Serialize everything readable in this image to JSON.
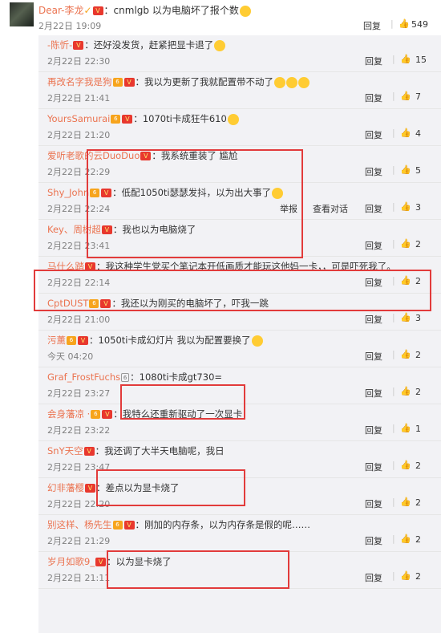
{
  "top": {
    "username": "Dear-李龙",
    "text": "：cnmlgb 以为电脑坏了报个数",
    "date": "2月22日 19:09",
    "reply": "回复",
    "sep": "|",
    "like_count": "549"
  },
  "badges": {
    "vip": "V",
    "level": "6",
    "gray": "6"
  },
  "actions": {
    "reply": "回复",
    "sep": "|",
    "report": "举报",
    "view_conversation": "查看对话"
  },
  "comments": [
    {
      "username": "-陈忻-",
      "text": "：还好没发货，赶紧把显卡退了",
      "date": "2月22日 22:30",
      "likes": "15"
    },
    {
      "username": "再改名字我是狗",
      "text": "：我以为更新了我就配置带不动了",
      "date": "2月22日 21:41",
      "likes": "7"
    },
    {
      "username": "YoursSamurai",
      "text": "：1070ti卡成狂牛610",
      "date": "2月22日 21:20",
      "likes": "4"
    },
    {
      "username": "爱听老歌的云DuoDuo",
      "text": "：我系统重装了 尴尬",
      "date": "2月22日 22:29",
      "likes": "5"
    },
    {
      "username": "Shy_John",
      "text": "：低配1050ti瑟瑟发抖，以为出大事了",
      "date": "2月22日 22:24",
      "likes": "3"
    },
    {
      "username": "Key、周树超",
      "text": "：我也以为电脑烧了",
      "date": "2月22日 23:41",
      "likes": "2"
    },
    {
      "username": "马什么踏",
      "text": "：我这种学生党买个笔记本开低画质才能玩这他妈一卡，，可是吓死我了。",
      "date": "2月22日 22:14",
      "likes": "2"
    },
    {
      "username": "CptDUST",
      "text": "：我还以为刚买的电脑坏了，吓我一跳",
      "date": "2月22日 21:00",
      "likes": "3"
    },
    {
      "username": "污薰",
      "text": "：1050ti卡成幻灯片 我以为配置要换了",
      "date": "今天 04:20",
      "likes": "2"
    },
    {
      "username": "Graf_FrostFuchs",
      "text": "：1080ti卡成gt730=",
      "date": "2月22日 23:27",
      "likes": "2"
    },
    {
      "username": "会身藩凉 ·",
      "text": "：我特么还重新驱动了一次显卡",
      "date": "2月22日 23:22",
      "likes": "1"
    },
    {
      "username": "SnY天空",
      "text": "：我还调了大半天电脑呢，我日",
      "date": "2月22日 23:47",
      "likes": "2"
    },
    {
      "username": "幻非藩樱",
      "text": "：差点以为显卡烧了",
      "date": "2月22日 22:20",
      "likes": "2"
    },
    {
      "username": "别这样、杨先生",
      "text": "：刚加的内存条，以为内存条是假的呢……",
      "date": "2月22日 21:29",
      "likes": "2"
    },
    {
      "username": "岁月如歌9_",
      "text": "：以为显卡烧了",
      "date": "2月22日 21:11",
      "likes": "2"
    }
  ]
}
